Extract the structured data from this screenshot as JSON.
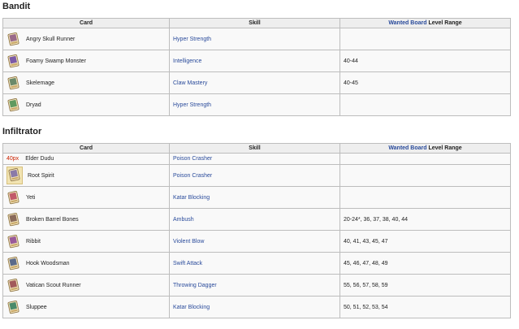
{
  "sections": [
    {
      "title": "Bandit",
      "headers": {
        "card": "Card",
        "skill": "Skill",
        "level_link": "Wanted Board",
        "level_rest": " Level Range"
      },
      "rows": [
        {
          "card": "Angry Skull Runner",
          "skill": "Hyper Strength",
          "level": "",
          "icon_color": "#9a6a8a"
        },
        {
          "card": "Foamy Swamp Monster",
          "skill": "Intelligence",
          "level": "40-44",
          "icon_color": "#7c5aa8"
        },
        {
          "card": "Skelemage",
          "skill": "Claw Mastery",
          "level": "40-45",
          "icon_color": "#6a8a6a"
        },
        {
          "card": "Dryad",
          "skill": "Hyper Strength",
          "level": "",
          "icon_color": "#5f9a5f"
        }
      ]
    },
    {
      "title": "Infiltrator",
      "headers": {
        "card": "Card",
        "skill": "Skill",
        "level_link": "Wanted Board",
        "level_rest": " Level Range"
      },
      "rows": [
        {
          "card": "Elder Dudu",
          "missing": "40px",
          "skill": "Poison Crasher",
          "level": ""
        },
        {
          "card": "Root Spirit",
          "skill": "Poison Crasher",
          "level": "",
          "icon_color": "#8a7aa8"
        },
        {
          "card": "Yeti",
          "skill": "Katar Blocking",
          "level": "",
          "icon_color": "#c25a6a"
        },
        {
          "card": "Broken Barrel Bones",
          "skill": "Ambush",
          "level": "20-24*, 36, 37, 38, 40, 44",
          "icon_color": "#8a6a5a"
        },
        {
          "card": "Ribbit",
          "skill": "Violent Blow",
          "level": "40, 41, 43, 45, 47",
          "icon_color": "#9a5a9a"
        },
        {
          "card": "Hook Woodsman",
          "skill": "Swift Attack",
          "level": "45, 46, 47, 48, 49",
          "icon_color": "#5a6a8a"
        },
        {
          "card": "Vatican Scout Runner",
          "skill": "Throwing Dagger",
          "level": "55, 56, 57, 58, 59",
          "icon_color": "#a25a5a"
        },
        {
          "card": "Sluppee",
          "skill": "Katar Blocking",
          "level": "50, 51, 52, 53, 54",
          "icon_color": "#4a8a6a"
        }
      ]
    }
  ]
}
